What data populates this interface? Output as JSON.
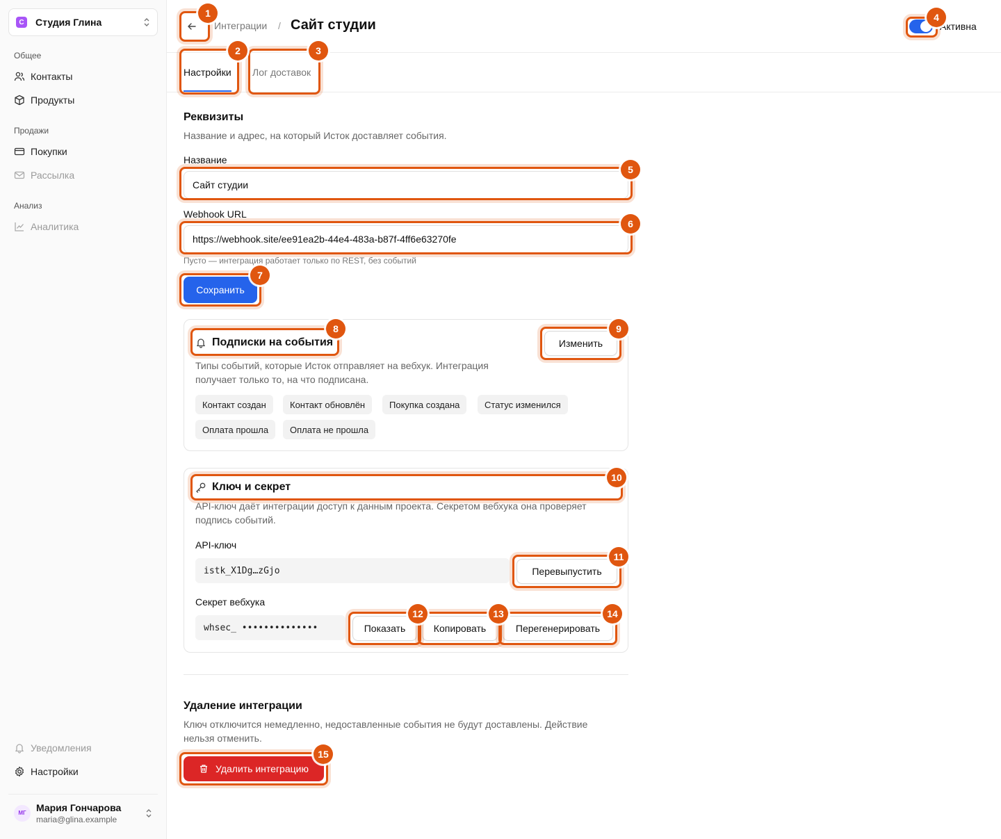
{
  "sidebar": {
    "workspace": {
      "logo_letter": "С",
      "name": "Студия Глина"
    },
    "groups": [
      {
        "label": "Общее",
        "items": [
          {
            "label": "Контакты",
            "icon": "users-icon"
          },
          {
            "label": "Продукты",
            "icon": "box-icon"
          }
        ]
      },
      {
        "label": "Продажи",
        "items": [
          {
            "label": "Покупки",
            "icon": "credit-card-icon"
          },
          {
            "label": "Рассылка",
            "icon": "mail-icon"
          }
        ]
      },
      {
        "label": "Анализ",
        "items": [
          {
            "label": "Аналитика",
            "icon": "chart-icon"
          }
        ]
      }
    ],
    "bottom": [
      {
        "label": "Уведомления",
        "icon": "bell-icon"
      },
      {
        "label": "Настройки",
        "icon": "gear-icon"
      }
    ],
    "user": {
      "initials": "МГ",
      "name": "Мария Гончарова",
      "email": "maria@glina.example"
    }
  },
  "header": {
    "breadcrumb": "Интеграции",
    "separator": "/",
    "title": "Сайт студии",
    "toggle_label": "Активна",
    "toggle_on": true
  },
  "tabs": [
    {
      "label": "Настройки",
      "active": true
    },
    {
      "label": "Лог доставок",
      "active": false
    }
  ],
  "details": {
    "title": "Реквизиты",
    "description": "Название и адрес, на который Исток доставляет события.",
    "name_label": "Название",
    "name_value": "Сайт студии",
    "url_label": "Webhook URL",
    "url_value": "https://webhook.site/ee91ea2b-44e4-483a-b87f-4ff6e63270fe",
    "url_hint": "Пусто — интеграция работает только по REST, без событий",
    "save_label": "Сохранить"
  },
  "subscriptions": {
    "title": "Подписки на события",
    "edit_label": "Изменить",
    "description_line1": "Типы событий, которые Исток отправляет на вебхук. Интеграция",
    "description_line2": "получает только то, на что подписана.",
    "events": [
      "Контакт создан",
      "Контакт обновлён",
      "Покупка создана",
      "Статус изменился",
      "Оплата прошла",
      "Оплата не прошла"
    ]
  },
  "keys": {
    "title": "Ключ и секрет",
    "description_line1": "API-ключ даёт интеграции доступ к данным проекта. Секретом вебхука она проверяет",
    "description_line2": "подпись событий.",
    "api_key_label": "API-ключ",
    "api_key_value": "istk_X1Dg…zGjo",
    "reissue_label": "Перевыпустить",
    "secret_label": "Секрет вебхука",
    "secret_value": "whsec_ ••••••••••••••",
    "show_label": "Показать",
    "copy_label": "Копировать",
    "regenerate_label": "Перегенерировать"
  },
  "danger": {
    "title": "Удаление интеграции",
    "description_line1": "Ключ отключится немедленно, недоставленные события не будут доставлены. Действие",
    "description_line2": "нельзя отменить.",
    "delete_label": "Удалить интеграцию"
  },
  "annotations": [
    "1",
    "2",
    "3",
    "4",
    "5",
    "6",
    "7",
    "8",
    "9",
    "10",
    "11",
    "12",
    "13",
    "14",
    "15"
  ],
  "colors": {
    "accent": "#2563eb",
    "danger": "#dc2626",
    "annotation": "#e0560f",
    "workspace_logo": "#a855f7"
  }
}
